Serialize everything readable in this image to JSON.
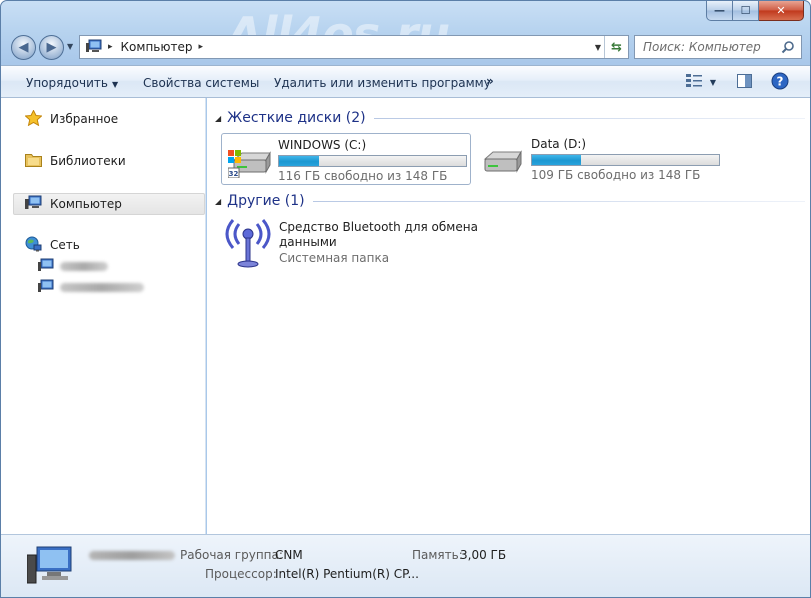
{
  "watermark": "All4os.ru",
  "window": {
    "minimize": "—",
    "maximize": "☐",
    "close": "✕"
  },
  "nav": {
    "back_icon": "◀",
    "forward_icon": "▶",
    "recent_icon": "▼"
  },
  "address": {
    "path_separator": "▸",
    "location": "Компьютер",
    "trailing_separator": "▸",
    "dropdown_icon": "▼",
    "refresh_icon": "⇆"
  },
  "search": {
    "placeholder": "Поиск: Компьютер"
  },
  "toolbar": {
    "organize": "Упорядочить",
    "organize_arrow": "▼",
    "system_properties": "Свойства системы",
    "uninstall": "Удалить или изменить программу",
    "more": "»",
    "view_arrow": "▼"
  },
  "sidebar": {
    "favorites": "Избранное",
    "libraries": "Библиотеки",
    "computer": "Компьютер",
    "network": "Сеть"
  },
  "groups": {
    "hard_drives": "Жесткие диски (2)",
    "other": "Другие (1)"
  },
  "drives": [
    {
      "name": "WINDOWS (C:)",
      "free": "116 ГБ свободно из 148 ГБ",
      "used_fraction": 0.216
    },
    {
      "name": "Data (D:)",
      "free": "109 ГБ свободно из 148 ГБ",
      "used_fraction": 0.264
    }
  ],
  "other_items": [
    {
      "name": "Средство Bluetooth для обмена данными",
      "type": "Системная папка"
    }
  ],
  "details": {
    "workgroup_label": "Рабочая группа:",
    "workgroup_value": "CNM",
    "memory_label": "Память:",
    "memory_value": "3,00 ГБ",
    "cpu_label": "Процессор:",
    "cpu_value": "Intel(R) Pentium(R) CP..."
  },
  "colors": {
    "group_title": "#1e3287",
    "drive_fill": "#1c97d1",
    "toolbar_text": "#1d3251"
  }
}
